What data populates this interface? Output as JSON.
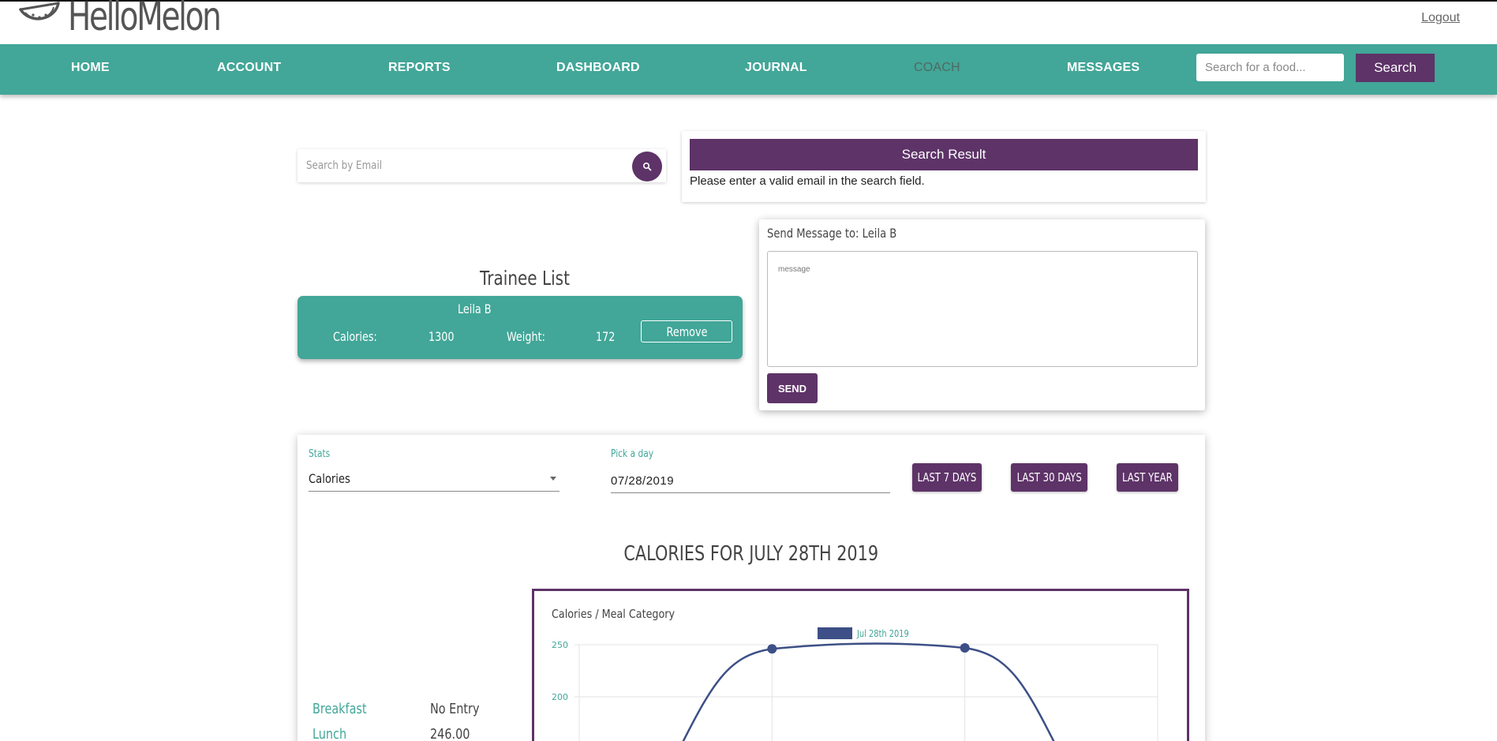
{
  "app": {
    "name": "HelloMelon",
    "logout_label": "Logout"
  },
  "nav": {
    "items": [
      "HOME",
      "ACCOUNT",
      "REPORTS",
      "DASHBOARD",
      "JOURNAL",
      "COACH",
      "MESSAGES"
    ],
    "active": "COACH",
    "search_placeholder": "Search for a food...",
    "search_label": "Search"
  },
  "email_search": {
    "placeholder": "Search by Email"
  },
  "search_result": {
    "title": "Search Result",
    "message": "Please enter a valid email in the search field."
  },
  "message": {
    "title": "Send Message to: Leila B",
    "placeholder": "message",
    "send_label": "SEND"
  },
  "trainee_list": {
    "title": "Trainee List",
    "trainees": [
      {
        "name": "Leila B",
        "calories_label": "Calories:",
        "calories": "1300",
        "weight_label": "Weight:",
        "weight": "172",
        "remove_label": "Remove"
      }
    ]
  },
  "stats": {
    "stats_label": "Stats",
    "stats_value": "Calories",
    "day_label": "Pick a day",
    "day_value": "07/28/2019",
    "range_buttons": [
      "LAST 7 DAYS",
      "LAST 30 DAYS",
      "LAST YEAR"
    ],
    "heading": "CALORIES FOR JULY 28TH 2019",
    "meals": [
      {
        "label": "Breakfast",
        "value": "No Entry"
      },
      {
        "label": "Lunch",
        "value": "246.00"
      }
    ]
  },
  "colors": {
    "teal": "#42a698",
    "purple": "#5e3368",
    "line": "#3d4f86"
  },
  "chart_data": {
    "type": "line",
    "title": "Calories / Meal Category",
    "legend": [
      "Jul 28th 2019"
    ],
    "y_ticks": [
      "250",
      "200"
    ],
    "series": [
      {
        "name": "Jul 28th 2019",
        "values": [
          null,
          246,
          247,
          null
        ]
      }
    ],
    "ylim": [
      null,
      250
    ]
  }
}
